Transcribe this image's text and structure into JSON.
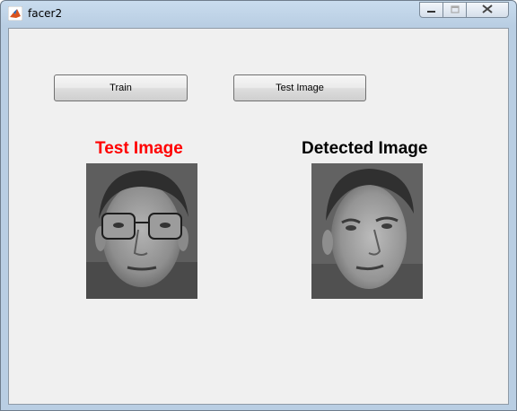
{
  "window": {
    "title": "facer2"
  },
  "buttons": {
    "train": "Train",
    "test_image": "Test Image"
  },
  "labels": {
    "test_image": "Test Image",
    "detected_image": "Detected Image",
    "test_color": "#ff0000",
    "detected_color": "#000000"
  },
  "images": {
    "test": {
      "icon": "face-photo-with-glasses"
    },
    "detected": {
      "icon": "face-photo"
    }
  },
  "title_controls": [
    "minimize-icon",
    "restore-icon",
    "close-icon"
  ]
}
